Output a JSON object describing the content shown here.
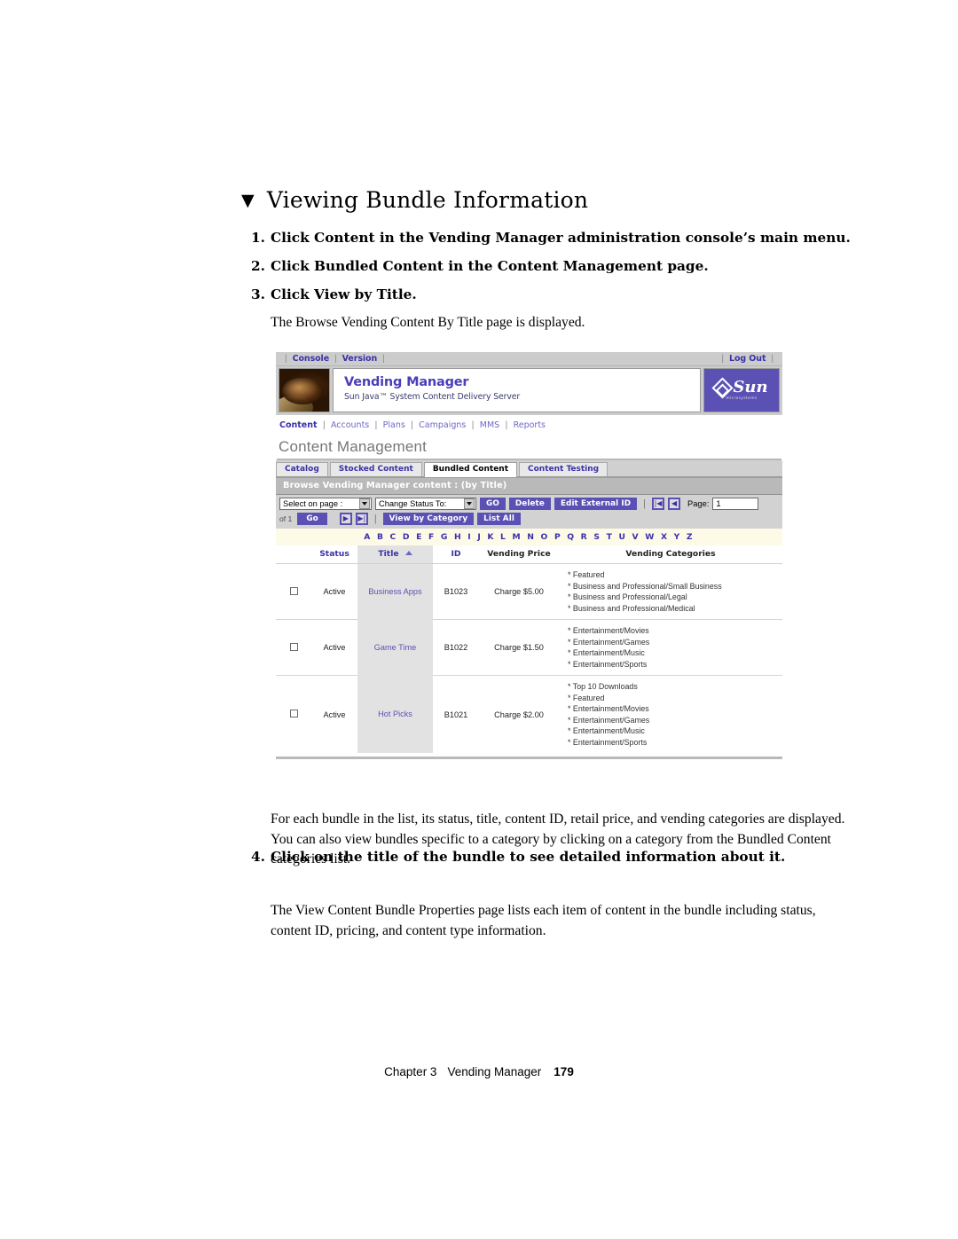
{
  "document": {
    "heading": "Viewing Bundle Information",
    "heading_bullet": "▼",
    "steps": [
      {
        "num": "1.",
        "text": "Click Content in the Vending Manager administration console’s main menu."
      },
      {
        "num": "2.",
        "text": "Click Bundled Content in the Content Management page."
      },
      {
        "num": "3.",
        "text": "Click View by Title."
      },
      {
        "num": "4.",
        "text": "Click on the title of the bundle to see detailed information about it."
      }
    ],
    "para_after_step3": "The Browse Vending Content By Title page is displayed.",
    "para_description": "For each bundle in the list, its status, title, content ID, retail price, and vending categories are displayed. You can also view bundles specific to a category by clicking on a category from the Bundled Content categories list.",
    "para_last": "The View Content Bundle Properties page lists each item of content in the bundle including status, content ID, pricing, and content type information.",
    "footer": {
      "chapter": "Chapter 3",
      "title": "Vending Manager",
      "page_number": "179"
    }
  },
  "screenshot": {
    "console_bar": {
      "left_links": [
        "Console",
        "Version"
      ],
      "right_links": [
        "Log Out"
      ]
    },
    "banner": {
      "product_title": "Vending Manager",
      "product_subtitle": "Sun Java™ System Content Delivery Server",
      "logo_word": "Sun",
      "logo_sub": "microsystems",
      "photo_alt": "coins-photo"
    },
    "main_nav": {
      "items": [
        "Content",
        "Accounts",
        "Plans",
        "Campaigns",
        "MMS",
        "Reports"
      ],
      "current": "Content"
    },
    "page_title": "Content Management",
    "tabs": [
      {
        "label": "Catalog",
        "active": false
      },
      {
        "label": "Stocked Content",
        "active": false
      },
      {
        "label": "Bundled Content",
        "active": true
      },
      {
        "label": "Content Testing",
        "active": false
      }
    ],
    "panel_header": "Browse Vending Manager content : (by Title)",
    "toolbar": {
      "select_on_page": "Select on page :",
      "change_status_to": "Change Status To:",
      "go_button": "GO",
      "delete_button": "Delete",
      "edit_external_id_button": "Edit External ID",
      "first_page_icon": "first-page-icon",
      "prev_page_icon": "previous-page-icon",
      "next_page_icon": "next-page-icon",
      "last_page_icon": "last-page-icon",
      "page_label": "Page:",
      "page_value": "1",
      "of_label": "of 1",
      "go_small_button": "Go",
      "view_by_category_button": "View by Category",
      "list_all_button": "List All"
    },
    "alphabet": "A B C D E F G H I J K L M N O P Q R S T U V W X Y Z",
    "table": {
      "columns": [
        "",
        "Status",
        "Title",
        "ID",
        "Vending Price",
        "Vending Categories"
      ],
      "sort_column": "Title",
      "sort_direction": "ascending",
      "rows": [
        {
          "checked": false,
          "status": "Active",
          "title": "Business Apps",
          "id": "B1023",
          "price": "Charge $5.00",
          "categories": [
            "* Featured",
            "* Business and Professional/Small Business",
            "* Business and Professional/Legal",
            "* Business and Professional/Medical"
          ]
        },
        {
          "checked": false,
          "status": "Active",
          "title": "Game Time",
          "id": "B1022",
          "price": "Charge $1.50",
          "categories": [
            "* Entertainment/Movies",
            "* Entertainment/Games",
            "* Entertainment/Music",
            "* Entertainment/Sports"
          ]
        },
        {
          "checked": false,
          "status": "Active",
          "title": "Hot Picks",
          "id": "B1021",
          "price": "Charge $2.00",
          "categories": [
            "* Top 10 Downloads",
            "* Featured",
            "* Entertainment/Movies",
            "* Entertainment/Games",
            "* Entertainment/Music",
            "* Entertainment/Sports"
          ]
        }
      ]
    },
    "colors": {
      "link_purple": "#3b31a8",
      "button_purple": "#5b51b5",
      "nav_purple": "#6f68c4",
      "chrome_gray": "#cccccc",
      "panel_gray": "#b9b9b9",
      "alpha_bg": "#fdfbe8",
      "title_col_bg": "#e2e2e2"
    }
  }
}
